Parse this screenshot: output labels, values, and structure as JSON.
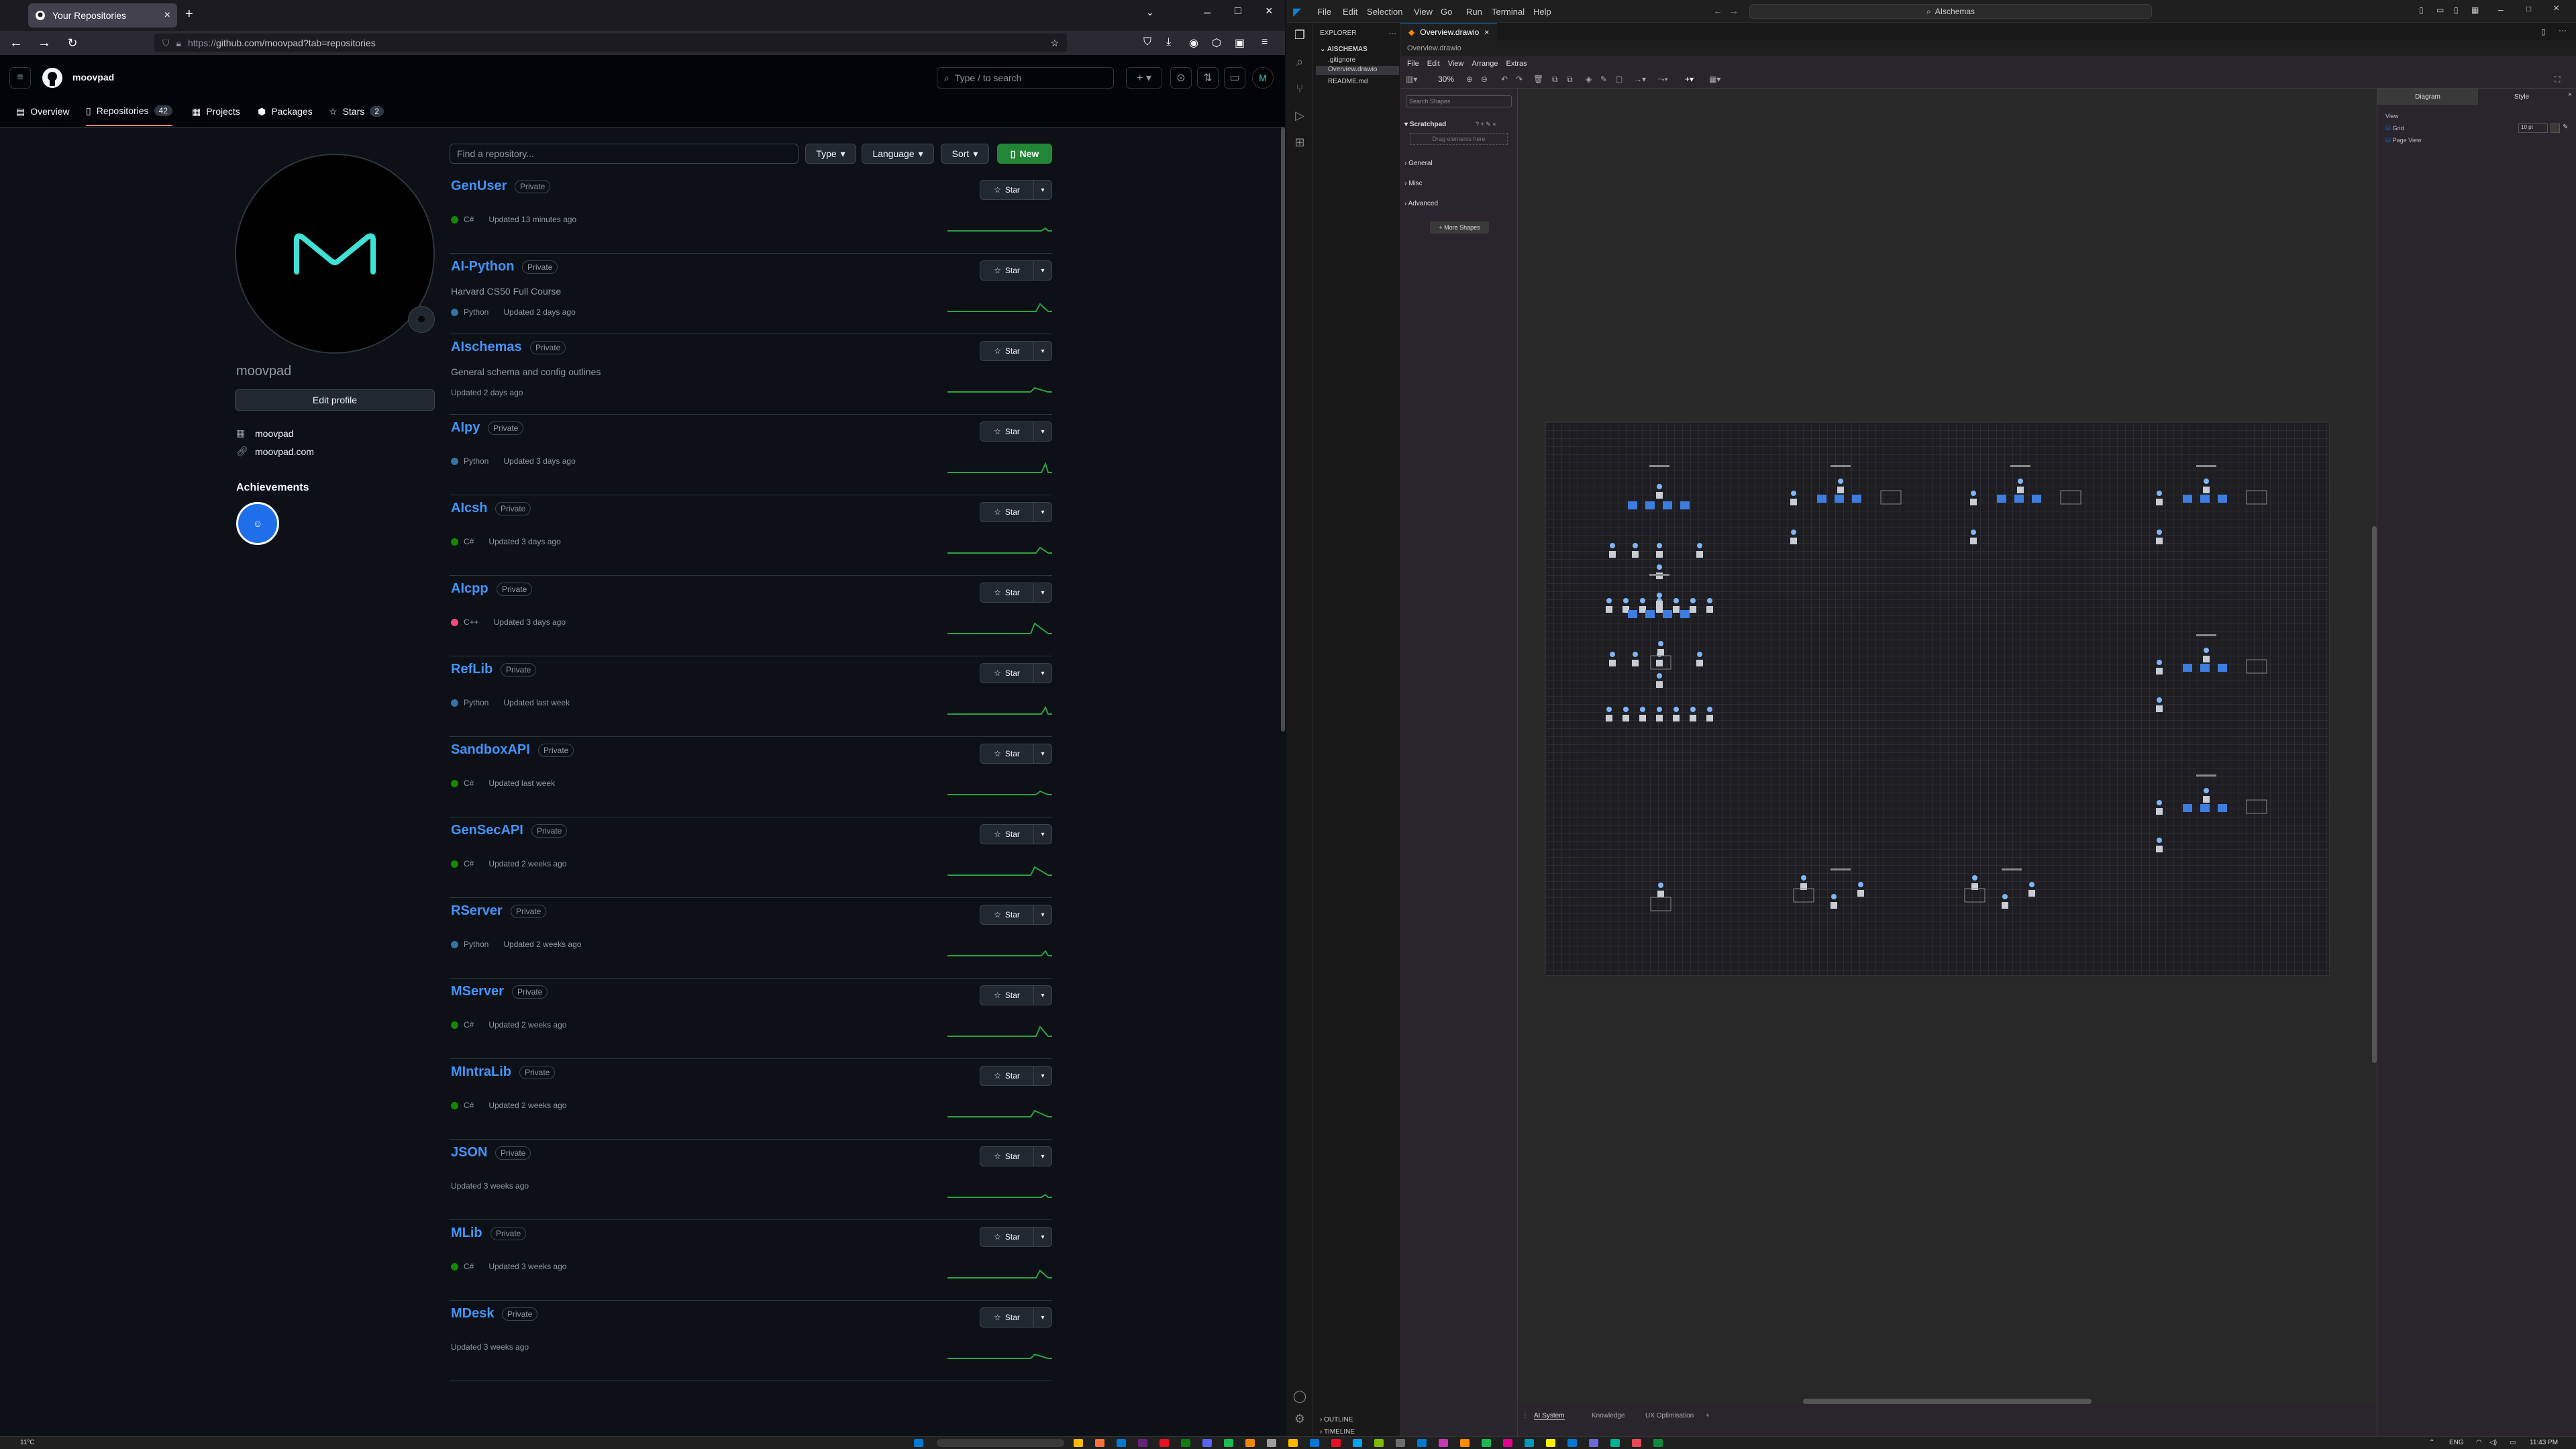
{
  "browser": {
    "tab_title": "Your Repositories",
    "url_prefix": "https://",
    "url": "github.com/moovpad?tab=repositories"
  },
  "github": {
    "username": "moovpad",
    "search_placeholder": "Type / to search",
    "nav": [
      {
        "label": "Overview",
        "count": ""
      },
      {
        "label": "Repositories",
        "count": "42"
      },
      {
        "label": "Projects",
        "count": ""
      },
      {
        "label": "Packages",
        "count": ""
      },
      {
        "label": "Stars",
        "count": "2"
      }
    ],
    "profile": {
      "name": "moovpad",
      "edit_label": "Edit profile",
      "org": "moovpad",
      "website": "moovpad.com",
      "achievements_title": "Achievements"
    },
    "repo_search_placeholder": "Find a repository...",
    "filters": [
      "Type",
      "Language",
      "Sort"
    ],
    "new_label": "New",
    "star_label": "Star",
    "private_label": "Private",
    "repos": [
      {
        "name": "GenUser",
        "desc": "",
        "lang": "C#",
        "lang_color": "#178600",
        "updated": "Updated 13 minutes ago"
      },
      {
        "name": "AI-Python",
        "desc": "Harvard CS50 Full Course",
        "lang": "Python",
        "lang_color": "#3572A5",
        "updated": "Updated 2 days ago"
      },
      {
        "name": "AIschemas",
        "desc": "General schema and config outlines",
        "lang": "",
        "lang_color": "",
        "updated": "Updated 2 days ago"
      },
      {
        "name": "AIpy",
        "desc": "",
        "lang": "Python",
        "lang_color": "#3572A5",
        "updated": "Updated 3 days ago"
      },
      {
        "name": "AIcsh",
        "desc": "",
        "lang": "C#",
        "lang_color": "#178600",
        "updated": "Updated 3 days ago"
      },
      {
        "name": "AIcpp",
        "desc": "",
        "lang": "C++",
        "lang_color": "#f34b7d",
        "updated": "Updated 3 days ago"
      },
      {
        "name": "RefLib",
        "desc": "",
        "lang": "Python",
        "lang_color": "#3572A5",
        "updated": "Updated last week"
      },
      {
        "name": "SandboxAPI",
        "desc": "",
        "lang": "C#",
        "lang_color": "#178600",
        "updated": "Updated last week"
      },
      {
        "name": "GenSecAPI",
        "desc": "",
        "lang": "C#",
        "lang_color": "#178600",
        "updated": "Updated 2 weeks ago"
      },
      {
        "name": "RServer",
        "desc": "",
        "lang": "Python",
        "lang_color": "#3572A5",
        "updated": "Updated 2 weeks ago"
      },
      {
        "name": "MServer",
        "desc": "",
        "lang": "C#",
        "lang_color": "#178600",
        "updated": "Updated 2 weeks ago"
      },
      {
        "name": "MIntraLib",
        "desc": "",
        "lang": "C#",
        "lang_color": "#178600",
        "updated": "Updated 2 weeks ago"
      },
      {
        "name": "JSON",
        "desc": "",
        "lang": "",
        "lang_color": "",
        "updated": "Updated 3 weeks ago"
      },
      {
        "name": "MLib",
        "desc": "",
        "lang": "C#",
        "lang_color": "#178600",
        "updated": "Updated 3 weeks ago"
      },
      {
        "name": "MDesk",
        "desc": "",
        "lang": "",
        "lang_color": "",
        "updated": "Updated 3 weeks ago"
      }
    ]
  },
  "vscode": {
    "menu": [
      "File",
      "Edit",
      "Selection",
      "View",
      "Go",
      "Run",
      "Terminal",
      "Help"
    ],
    "command_center": "AIschemas",
    "explorer_title": "EXPLORER",
    "workspace": "AISCHEMAS",
    "files": [
      ".gitignore",
      "Overview.drawio",
      "README.md"
    ],
    "outline": "OUTLINE",
    "timeline": "TIMELINE",
    "editor_tab": "Overview.drawio",
    "breadcrumb": "Overview.drawio"
  },
  "drawio": {
    "menu": [
      "File",
      "Edit",
      "View",
      "Arrange",
      "Extras"
    ],
    "zoom": "30%",
    "search_placeholder": "Search Shapes",
    "scratchpad": "Scratchpad",
    "scratch_drop": "Drag elements here",
    "sections": [
      "General",
      "Misc",
      "Advanced"
    ],
    "more_shapes": "+ More Shapes",
    "format_tabs": [
      "Diagram",
      "Style"
    ],
    "view_label": "View",
    "grid_label": "Grid",
    "grid_size": "10 pt",
    "page_view_label": "Page View",
    "page_tabs": [
      "AI System",
      "Knowledge",
      "UX Optimisation"
    ]
  },
  "taskbar": {
    "weather": "11°C",
    "lang": "ENG",
    "time": "11:43 PM"
  }
}
